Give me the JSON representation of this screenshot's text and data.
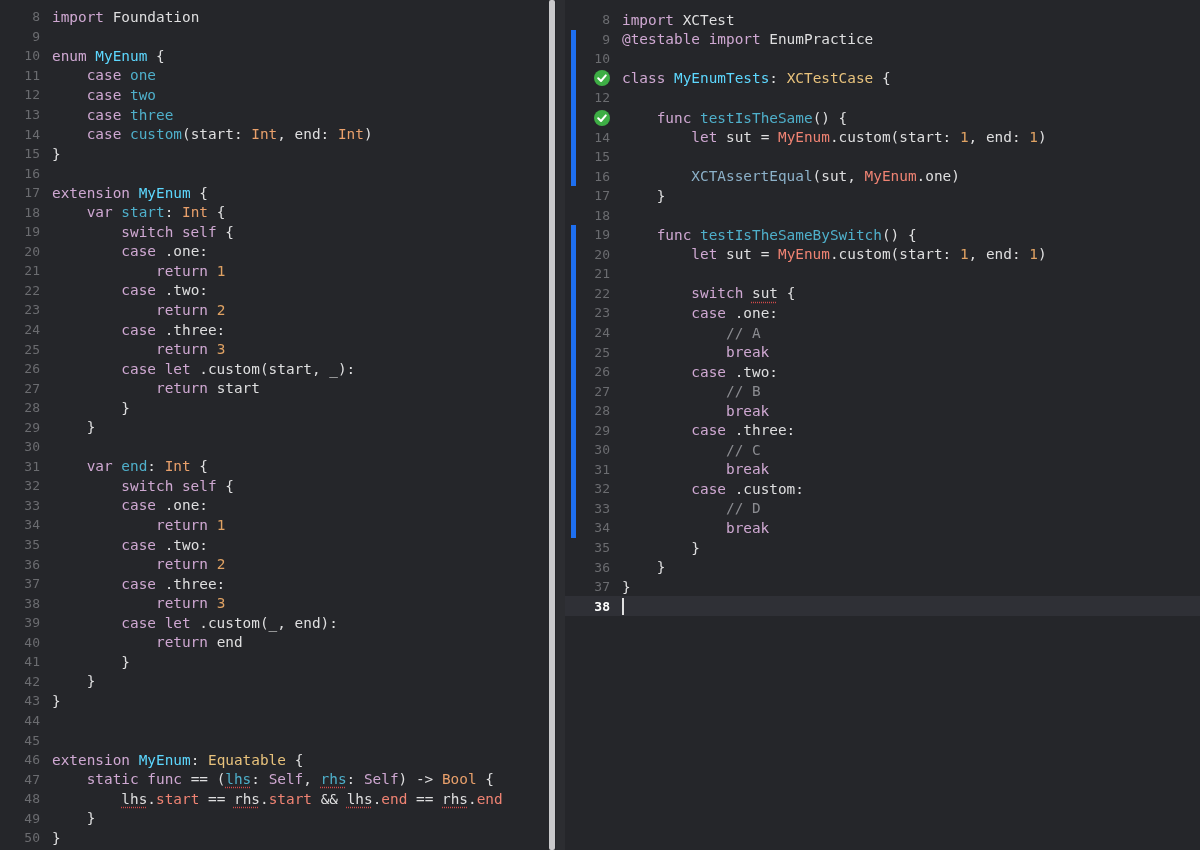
{
  "panes": [
    {
      "lines": [
        {
          "number": "8",
          "tokens": [
            {
              "text": "import",
              "kind": "keyword"
            },
            {
              "text": " Foundation",
              "kind": "plain"
            }
          ]
        },
        {
          "number": "9"
        },
        {
          "number": "10",
          "tokens": [
            {
              "text": "enum",
              "kind": "keyword"
            },
            {
              "text": " MyEnum",
              "kind": "declaration"
            },
            {
              "text": " {",
              "kind": "plain"
            }
          ]
        },
        {
          "number": "11",
          "tokens": [
            {
              "text": "    case",
              "kind": "keyword"
            },
            {
              "text": " one",
              "kind": "member"
            }
          ]
        },
        {
          "number": "12",
          "tokens": [
            {
              "text": "    case",
              "kind": "keyword"
            },
            {
              "text": " two",
              "kind": "member"
            }
          ]
        },
        {
          "number": "13",
          "tokens": [
            {
              "text": "    case",
              "kind": "keyword"
            },
            {
              "text": " three",
              "kind": "member"
            }
          ]
        },
        {
          "number": "14",
          "tokens": [
            {
              "text": "    case",
              "kind": "keyword"
            },
            {
              "text": " custom",
              "kind": "member"
            },
            {
              "text": "(start: ",
              "kind": "plain"
            },
            {
              "text": "Int",
              "kind": "type"
            },
            {
              "text": ", end: ",
              "kind": "plain"
            },
            {
              "text": "Int",
              "kind": "type"
            },
            {
              "text": ")",
              "kind": "plain"
            }
          ]
        },
        {
          "number": "15",
          "tokens": [
            {
              "text": "}",
              "kind": "plain"
            }
          ]
        },
        {
          "number": "16"
        },
        {
          "number": "17",
          "tokens": [
            {
              "text": "extension",
              "kind": "keyword"
            },
            {
              "text": " MyEnum",
              "kind": "declaration"
            },
            {
              "text": " {",
              "kind": "plain"
            }
          ]
        },
        {
          "number": "18",
          "tokens": [
            {
              "text": "    var",
              "kind": "keyword"
            },
            {
              "text": " start",
              "kind": "member"
            },
            {
              "text": ": ",
              "kind": "plain"
            },
            {
              "text": "Int",
              "kind": "type"
            },
            {
              "text": " {",
              "kind": "plain"
            }
          ]
        },
        {
          "number": "19",
          "tokens": [
            {
              "text": "        switch self",
              "kind": "keyword"
            },
            {
              "text": " {",
              "kind": "plain"
            }
          ]
        },
        {
          "number": "20",
          "tokens": [
            {
              "text": "        case",
              "kind": "keyword"
            },
            {
              "text": " .one:",
              "kind": "plain"
            }
          ]
        },
        {
          "number": "21",
          "tokens": [
            {
              "text": "            return",
              "kind": "keyword"
            },
            {
              "text": " 1",
              "kind": "number"
            }
          ]
        },
        {
          "number": "22",
          "tokens": [
            {
              "text": "        case",
              "kind": "keyword"
            },
            {
              "text": " .two:",
              "kind": "plain"
            }
          ]
        },
        {
          "number": "23",
          "tokens": [
            {
              "text": "            return",
              "kind": "keyword"
            },
            {
              "text": " 2",
              "kind": "number"
            }
          ]
        },
        {
          "number": "24",
          "tokens": [
            {
              "text": "        case",
              "kind": "keyword"
            },
            {
              "text": " .three:",
              "kind": "plain"
            }
          ]
        },
        {
          "number": "25",
          "tokens": [
            {
              "text": "            return",
              "kind": "keyword"
            },
            {
              "text": " 3",
              "kind": "number"
            }
          ]
        },
        {
          "number": "26",
          "tokens": [
            {
              "text": "        case let",
              "kind": "keyword"
            },
            {
              "text": " .custom(start, _):",
              "kind": "plain"
            }
          ]
        },
        {
          "number": "27",
          "tokens": [
            {
              "text": "            return",
              "kind": "keyword"
            },
            {
              "text": " start",
              "kind": "plain"
            }
          ]
        },
        {
          "number": "28",
          "tokens": [
            {
              "text": "        }",
              "kind": "plain"
            }
          ]
        },
        {
          "number": "29",
          "tokens": [
            {
              "text": "    }",
              "kind": "plain"
            }
          ]
        },
        {
          "number": "30"
        },
        {
          "number": "31",
          "tokens": [
            {
              "text": "    var",
              "kind": "keyword"
            },
            {
              "text": " end",
              "kind": "member"
            },
            {
              "text": ": ",
              "kind": "plain"
            },
            {
              "text": "Int",
              "kind": "type"
            },
            {
              "text": " {",
              "kind": "plain"
            }
          ]
        },
        {
          "number": "32",
          "tokens": [
            {
              "text": "        switch self",
              "kind": "keyword"
            },
            {
              "text": " {",
              "kind": "plain"
            }
          ]
        },
        {
          "number": "33",
          "tokens": [
            {
              "text": "        case",
              "kind": "keyword"
            },
            {
              "text": " .one:",
              "kind": "plain"
            }
          ]
        },
        {
          "number": "34",
          "tokens": [
            {
              "text": "            return",
              "kind": "keyword"
            },
            {
              "text": " 1",
              "kind": "number"
            }
          ]
        },
        {
          "number": "35",
          "tokens": [
            {
              "text": "        case",
              "kind": "keyword"
            },
            {
              "text": " .two:",
              "kind": "plain"
            }
          ]
        },
        {
          "number": "36",
          "tokens": [
            {
              "text": "            return",
              "kind": "keyword"
            },
            {
              "text": " 2",
              "kind": "number"
            }
          ]
        },
        {
          "number": "37",
          "tokens": [
            {
              "text": "        case",
              "kind": "keyword"
            },
            {
              "text": " .three:",
              "kind": "plain"
            }
          ]
        },
        {
          "number": "38",
          "tokens": [
            {
              "text": "            return",
              "kind": "keyword"
            },
            {
              "text": " 3",
              "kind": "number"
            }
          ]
        },
        {
          "number": "39",
          "tokens": [
            {
              "text": "        case let",
              "kind": "keyword"
            },
            {
              "text": " .custom(_, end):",
              "kind": "plain"
            }
          ]
        },
        {
          "number": "40",
          "tokens": [
            {
              "text": "            return",
              "kind": "keyword"
            },
            {
              "text": " end",
              "kind": "plain"
            }
          ]
        },
        {
          "number": "41",
          "tokens": [
            {
              "text": "        }",
              "kind": "plain"
            }
          ]
        },
        {
          "number": "42",
          "tokens": [
            {
              "text": "    }",
              "kind": "plain"
            }
          ]
        },
        {
          "number": "43",
          "tokens": [
            {
              "text": "}",
              "kind": "plain"
            }
          ]
        },
        {
          "number": "44"
        },
        {
          "number": "45"
        },
        {
          "number": "46",
          "tokens": [
            {
              "text": "extension",
              "kind": "keyword"
            },
            {
              "text": " MyEnum",
              "kind": "declaration"
            },
            {
              "text": ": ",
              "kind": "plain"
            },
            {
              "text": "Equatable",
              "kind": "protocol"
            },
            {
              "text": " {",
              "kind": "plain"
            }
          ]
        },
        {
          "number": "47",
          "tokens": [
            {
              "text": "    static func",
              "kind": "keyword"
            },
            {
              "text": " == (",
              "kind": "plain"
            },
            {
              "text": "lhs",
              "kind": "member",
              "underlined": true
            },
            {
              "text": ": ",
              "kind": "plain"
            },
            {
              "text": "Self",
              "kind": "keyword"
            },
            {
              "text": ", ",
              "kind": "plain"
            },
            {
              "text": "rhs",
              "kind": "member",
              "underlined": true
            },
            {
              "text": ": ",
              "kind": "plain"
            },
            {
              "text": "Self",
              "kind": "keyword"
            },
            {
              "text": ") -> ",
              "kind": "plain"
            },
            {
              "text": "Bool",
              "kind": "type"
            },
            {
              "text": " {",
              "kind": "plain"
            }
          ]
        },
        {
          "number": "48",
          "tokens": [
            {
              "text": "        lhs",
              "kind": "plain",
              "underlined": true
            },
            {
              "text": ".",
              "kind": "plain"
            },
            {
              "text": "start",
              "kind": "reference"
            },
            {
              "text": " == ",
              "kind": "plain"
            },
            {
              "text": "rhs",
              "kind": "plain",
              "underlined": true
            },
            {
              "text": ".",
              "kind": "plain"
            },
            {
              "text": "start",
              "kind": "reference"
            },
            {
              "text": " && ",
              "kind": "plain"
            },
            {
              "text": "lhs",
              "kind": "plain",
              "underlined": true
            },
            {
              "text": ".",
              "kind": "plain"
            },
            {
              "text": "end",
              "kind": "reference"
            },
            {
              "text": " == ",
              "kind": "plain"
            },
            {
              "text": "rhs",
              "kind": "plain",
              "underlined": true
            },
            {
              "text": ".",
              "kind": "plain"
            },
            {
              "text": "end",
              "kind": "reference"
            }
          ]
        },
        {
          "number": "49",
          "tokens": [
            {
              "text": "    }",
              "kind": "plain"
            }
          ]
        },
        {
          "number": "50",
          "tokens": [
            {
              "text": "}",
              "kind": "plain"
            }
          ]
        }
      ]
    },
    {
      "lines": [
        {
          "number": "8",
          "changed": false,
          "current": false,
          "tokens": [
            {
              "text": "import",
              "kind": "keyword"
            },
            {
              "text": " XCTest",
              "kind": "plain"
            }
          ]
        },
        {
          "number": "9",
          "changed": true,
          "current": false,
          "tokens": [
            {
              "text": "@testable import",
              "kind": "keyword"
            },
            {
              "text": " EnumPractice",
              "kind": "plain"
            }
          ]
        },
        {
          "number": "10",
          "changed": true,
          "current": false
        },
        {
          "test_passed": true,
          "changed": true,
          "current": false,
          "tokens": [
            {
              "text": "class",
              "kind": "keyword"
            },
            {
              "text": " MyEnumTests",
              "kind": "declaration"
            },
            {
              "text": ": ",
              "kind": "plain"
            },
            {
              "text": "XCTestCase",
              "kind": "protocol"
            },
            {
              "text": " {",
              "kind": "plain"
            }
          ]
        },
        {
          "number": "12",
          "changed": true,
          "current": false
        },
        {
          "test_passed": true,
          "changed": true,
          "current": false,
          "tokens": [
            {
              "text": "    func",
              "kind": "keyword"
            },
            {
              "text": " testIsTheSame",
              "kind": "member"
            },
            {
              "text": "() {",
              "kind": "plain"
            }
          ]
        },
        {
          "number": "14",
          "changed": true,
          "current": false,
          "tokens": [
            {
              "text": "        let",
              "kind": "keyword"
            },
            {
              "text": " sut = ",
              "kind": "plain"
            },
            {
              "text": "MyEnum",
              "kind": "reference"
            },
            {
              "text": ".custom(start: ",
              "kind": "plain"
            },
            {
              "text": "1",
              "kind": "number"
            },
            {
              "text": ", end: ",
              "kind": "plain"
            },
            {
              "text": "1",
              "kind": "number"
            },
            {
              "text": ")",
              "kind": "plain"
            }
          ]
        },
        {
          "number": "15",
          "changed": true,
          "current": false
        },
        {
          "number": "16",
          "changed": true,
          "current": false,
          "tokens": [
            {
              "text": "        XCTAssertEqual",
              "kind": "call"
            },
            {
              "text": "(sut, ",
              "kind": "plain"
            },
            {
              "text": "MyEnum",
              "kind": "reference"
            },
            {
              "text": ".one)",
              "kind": "plain"
            }
          ]
        },
        {
          "number": "17",
          "changed": false,
          "current": false,
          "tokens": [
            {
              "text": "    }",
              "kind": "plain"
            }
          ]
        },
        {
          "number": "18",
          "changed": false,
          "current": false
        },
        {
          "number": "19",
          "changed": true,
          "current": false,
          "tokens": [
            {
              "text": "    func",
              "kind": "keyword"
            },
            {
              "text": " testIsTheSameBySwitch",
              "kind": "member"
            },
            {
              "text": "() {",
              "kind": "plain"
            }
          ]
        },
        {
          "number": "20",
          "changed": true,
          "current": false,
          "tokens": [
            {
              "text": "        let",
              "kind": "keyword"
            },
            {
              "text": " sut = ",
              "kind": "plain"
            },
            {
              "text": "MyEnum",
              "kind": "reference"
            },
            {
              "text": ".custom(start: ",
              "kind": "plain"
            },
            {
              "text": "1",
              "kind": "number"
            },
            {
              "text": ", end: ",
              "kind": "plain"
            },
            {
              "text": "1",
              "kind": "number"
            },
            {
              "text": ")",
              "kind": "plain"
            }
          ]
        },
        {
          "number": "21",
          "changed": true,
          "current": false
        },
        {
          "number": "22",
          "changed": true,
          "current": false,
          "tokens": [
            {
              "text": "        switch ",
              "kind": "keyword"
            },
            {
              "text": "sut",
              "kind": "plain",
              "underlined": true
            },
            {
              "text": " {",
              "kind": "plain"
            }
          ]
        },
        {
          "number": "23",
          "changed": true,
          "current": false,
          "tokens": [
            {
              "text": "        case",
              "kind": "keyword"
            },
            {
              "text": " .one:",
              "kind": "plain"
            }
          ]
        },
        {
          "number": "24",
          "changed": true,
          "current": false,
          "tokens": [
            {
              "text": "            // A",
              "kind": "comment"
            }
          ]
        },
        {
          "number": "25",
          "changed": true,
          "current": false,
          "tokens": [
            {
              "text": "            break",
              "kind": "keyword"
            }
          ]
        },
        {
          "number": "26",
          "changed": true,
          "current": false,
          "tokens": [
            {
              "text": "        case",
              "kind": "keyword"
            },
            {
              "text": " .two:",
              "kind": "plain"
            }
          ]
        },
        {
          "number": "27",
          "changed": true,
          "current": false,
          "tokens": [
            {
              "text": "            // B",
              "kind": "comment"
            }
          ]
        },
        {
          "number": "28",
          "changed": true,
          "current": false,
          "tokens": [
            {
              "text": "            break",
              "kind": "keyword"
            }
          ]
        },
        {
          "number": "29",
          "changed": true,
          "current": false,
          "tokens": [
            {
              "text": "        case",
              "kind": "keyword"
            },
            {
              "text": " .three:",
              "kind": "plain"
            }
          ]
        },
        {
          "number": "30",
          "changed": true,
          "current": false,
          "tokens": [
            {
              "text": "            // C",
              "kind": "comment"
            }
          ]
        },
        {
          "number": "31",
          "changed": true,
          "current": false,
          "tokens": [
            {
              "text": "            break",
              "kind": "keyword"
            }
          ]
        },
        {
          "number": "32",
          "changed": true,
          "current": false,
          "tokens": [
            {
              "text": "        case",
              "kind": "keyword"
            },
            {
              "text": " .custom:",
              "kind": "plain"
            }
          ]
        },
        {
          "number": "33",
          "changed": true,
          "current": false,
          "tokens": [
            {
              "text": "            // D",
              "kind": "comment"
            }
          ]
        },
        {
          "number": "34",
          "changed": true,
          "current": false,
          "tokens": [
            {
              "text": "            break",
              "kind": "keyword"
            }
          ]
        },
        {
          "number": "35",
          "changed": false,
          "current": false,
          "tokens": [
            {
              "text": "        }",
              "kind": "plain"
            }
          ]
        },
        {
          "number": "36",
          "changed": false,
          "current": false,
          "tokens": [
            {
              "text": "    }",
              "kind": "plain"
            }
          ]
        },
        {
          "number": "37",
          "changed": false,
          "current": false,
          "tokens": [
            {
              "text": "}",
              "kind": "plain"
            }
          ]
        },
        {
          "number": "38",
          "changed": false,
          "current": true
        }
      ]
    }
  ]
}
